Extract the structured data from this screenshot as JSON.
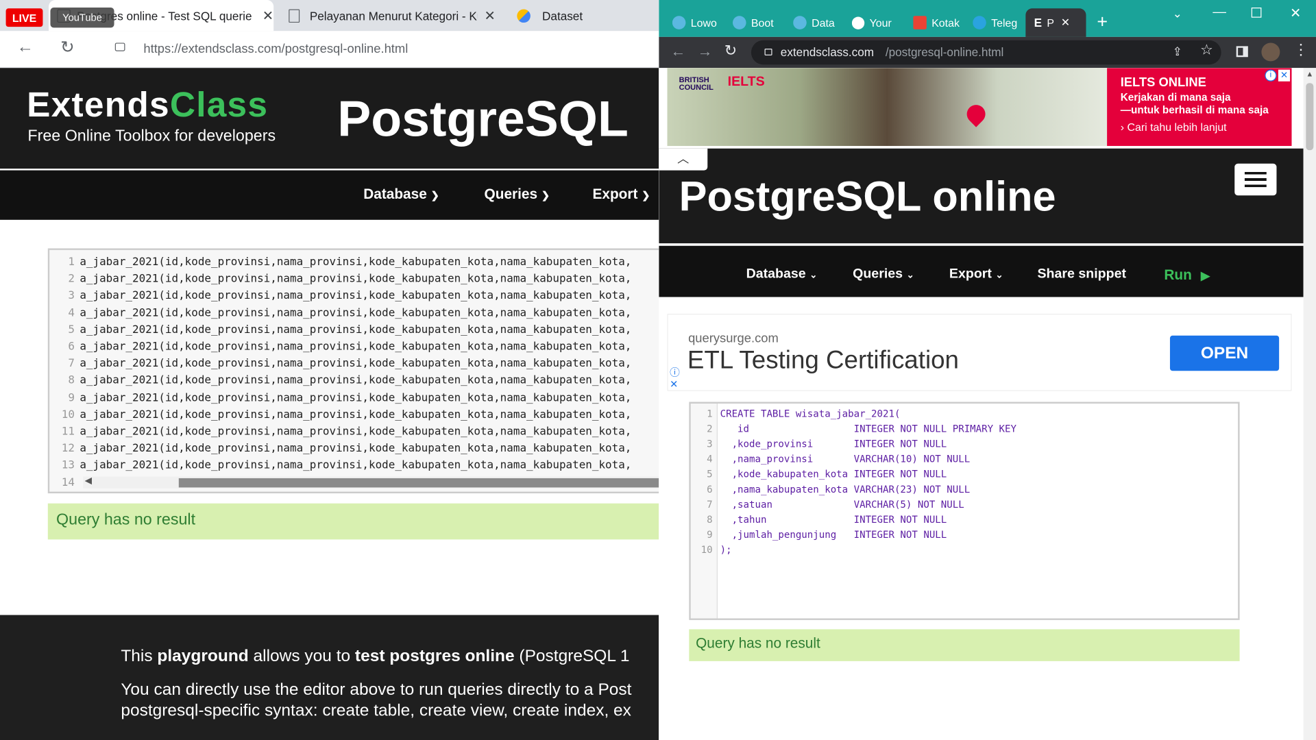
{
  "left": {
    "tabs": [
      {
        "label": "Postgres online - Test SQL querie"
      },
      {
        "label": "Pelayanan Menurut Kategori - Ku"
      },
      {
        "label": "Dataset"
      }
    ],
    "live_badge": "LIVE",
    "youtube_tooltip": "YouTube",
    "url": "https://extendsclass.com/postgresql-online.html",
    "brand_part1": "Extends",
    "brand_part2": "Class",
    "tagline": "Free Online Toolbox for developers",
    "hero_title": "PostgreSQL",
    "nav": [
      "Database",
      "Queries",
      "Export"
    ],
    "editor_line": "a_jabar_2021(id,kode_provinsi,nama_provinsi,kode_kabupaten_kota,nama_kabupaten_kota,",
    "line_numbers": [
      "1",
      "2",
      "3",
      "4",
      "5",
      "6",
      "7",
      "8",
      "9",
      "10",
      "11",
      "12",
      "13",
      "14"
    ],
    "result": "Query has no result",
    "footer": {
      "p1_a": "This ",
      "p1_b": "playground",
      "p1_c": " allows you to ",
      "p1_d": "test postgres online",
      "p1_e": " (PostgreSQL 1",
      "p2": "You can directly use the editor above to run queries directly to a Post",
      "p3": "postgresql-specific syntax: create table, create view, create index, ex"
    }
  },
  "right": {
    "tabs": [
      "Lowo",
      "Boot",
      "Data",
      "Your",
      "Kotak",
      "Teleg",
      "P"
    ],
    "url_host": "extendsclass.com",
    "url_path": "/postgresql-online.html",
    "ad_top": {
      "brand": "BRITISH COUNCIL",
      "product": "IELTS",
      "headline": "IELTS ONLINE",
      "line1": "Kerjakan di mana saja",
      "line2": "—untuk berhasil di mana saja",
      "cta": "Cari tahu lebih lanjut"
    },
    "hero_title": "PostgreSQL online",
    "nav": [
      "Database",
      "Queries",
      "Export",
      "Share snippet",
      "Run"
    ],
    "ad2": {
      "domain": "querysurge.com",
      "title": "ETL Testing Certification",
      "button": "OPEN"
    },
    "sql_lines": [
      "CREATE TABLE wisata_jabar_2021(",
      "   id                  INTEGER NOT NULL PRIMARY KEY",
      "  ,kode_provinsi       INTEGER NOT NULL",
      "  ,nama_provinsi       VARCHAR(10) NOT NULL",
      "  ,kode_kabupaten_kota INTEGER NOT NULL",
      "  ,nama_kabupaten_kota VARCHAR(23) NOT NULL",
      "  ,satuan              VARCHAR(5) NOT NULL",
      "  ,tahun               INTEGER NOT NULL",
      "  ,jumlah_pengunjung   INTEGER NOT NULL",
      ");"
    ],
    "line_numbers": [
      "1",
      "2",
      "3",
      "4",
      "5",
      "6",
      "7",
      "8",
      "9",
      "10"
    ],
    "result": "Query has no result"
  },
  "colors": {
    "teal": "#1aa399",
    "brand_green": "#3cc05b",
    "run_green": "#3cc05b",
    "ad_red": "#e4003b",
    "open_blue": "#1a73e8"
  }
}
